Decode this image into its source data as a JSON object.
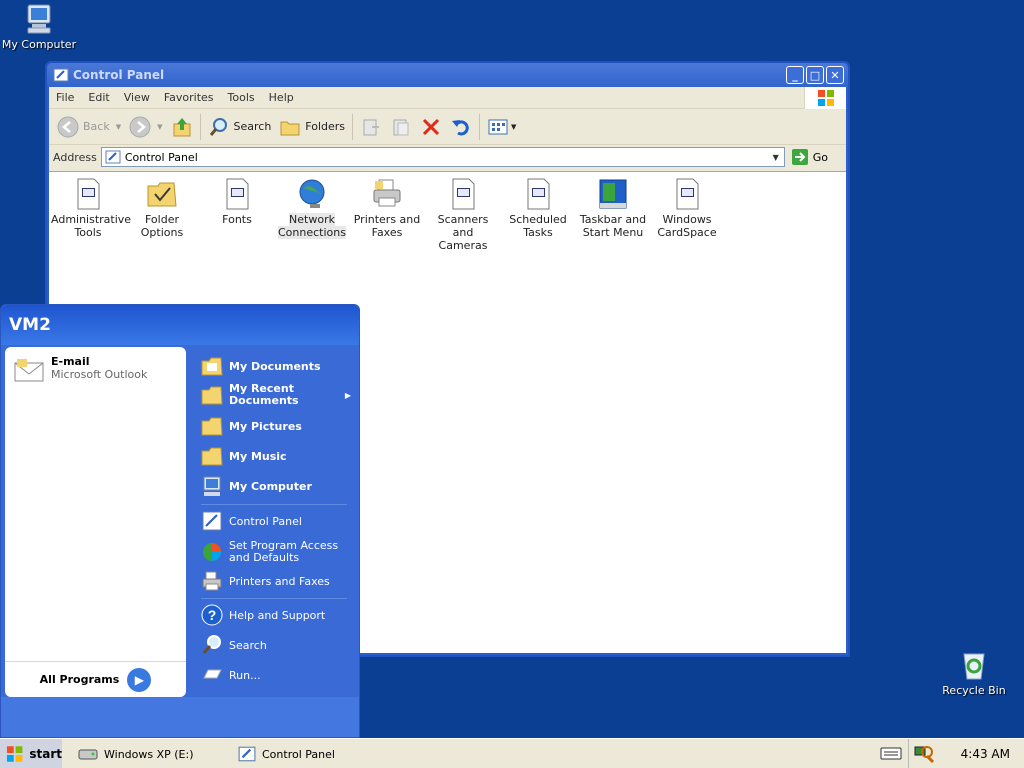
{
  "desktop": {
    "my_computer": "My Computer",
    "recycle_bin": "Recycle Bin"
  },
  "window": {
    "title": "Control Panel",
    "menu": [
      "File",
      "Edit",
      "View",
      "Favorites",
      "Tools",
      "Help"
    ],
    "toolbar": {
      "back": "Back",
      "search": "Search",
      "folders": "Folders"
    },
    "address": {
      "label": "Address",
      "value": "Control Panel",
      "go": "Go"
    },
    "items": [
      {
        "label1": "Administrative",
        "label2": "Tools",
        "icon": "admin-tools-icon"
      },
      {
        "label1": "Folder Options",
        "label2": "",
        "icon": "folder-options-icon"
      },
      {
        "label1": "Fonts",
        "label2": "",
        "icon": "fonts-icon"
      },
      {
        "label1": "Network",
        "label2": "Connections",
        "icon": "network-icon"
      },
      {
        "label1": "Printers and",
        "label2": "Faxes",
        "icon": "printer-icon"
      },
      {
        "label1": "Scanners and",
        "label2": "Cameras",
        "icon": "scanner-icon"
      },
      {
        "label1": "Scheduled",
        "label2": "Tasks",
        "icon": "scheduled-tasks-icon"
      },
      {
        "label1": "Taskbar and",
        "label2": "Start Menu",
        "icon": "taskbar-icon"
      },
      {
        "label1": "Windows",
        "label2": "CardSpace",
        "icon": "cardspace-icon"
      }
    ]
  },
  "start_menu": {
    "user": "VM2",
    "pinned": {
      "title": "E-mail",
      "subtitle": "Microsoft Outlook"
    },
    "all_programs": "All Programs",
    "right": {
      "my_documents": "My Documents",
      "my_recent_1": "My Recent",
      "my_recent_2": "Documents",
      "my_pictures": "My Pictures",
      "my_music": "My Music",
      "my_computer": "My Computer",
      "control_panel": "Control Panel",
      "set_program_1": "Set Program Access",
      "set_program_2": "and Defaults",
      "printers": "Printers and Faxes",
      "help": "Help and Support",
      "search": "Search",
      "run": "Run..."
    }
  },
  "taskbar": {
    "start": "start",
    "tasks": [
      "Windows XP (E:)",
      "Control Panel"
    ],
    "clock": "4:43 AM"
  },
  "colors": {
    "desktop": "#0a3f94",
    "start_menu_blue": "#3a6ad6",
    "taskbar": "#ece9d8"
  }
}
